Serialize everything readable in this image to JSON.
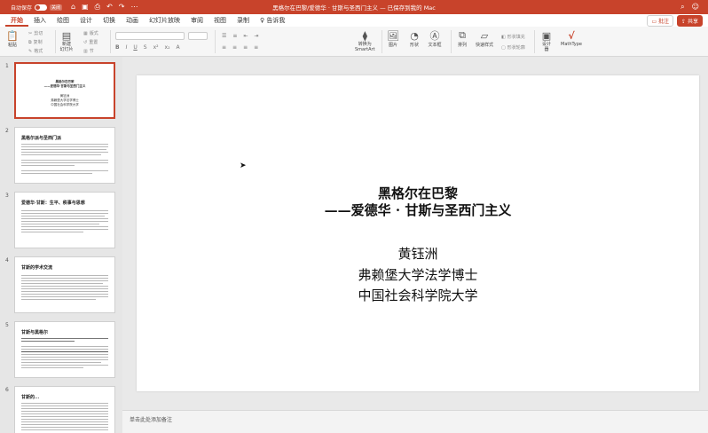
{
  "titlebar": {
    "autosave_label": "自动保存",
    "toggle_label": "关闭",
    "doc_title": "黑格尔在巴黎/爱德华 · 甘斯与圣西门主义 — 已保存到我的 Mac",
    "accent_color": "#c8432b"
  },
  "tabs": [
    "开始",
    "插入",
    "绘图",
    "设计",
    "切换",
    "动画",
    "幻灯片放映",
    "审阅",
    "视图",
    "录制",
    "告诉我"
  ],
  "tab_right": {
    "comments": "批注",
    "share": "共享"
  },
  "ribbon": {
    "paste": "粘贴",
    "cut": "剪切",
    "copy": "复制",
    "format": "格式",
    "new_slide": "新建\n幻灯片",
    "layout": "版式",
    "reset": "重置",
    "section": "节",
    "convert_smartart": "转换为\nSmartArt",
    "picture": "图片",
    "shape": "形状",
    "textbox": "文本框",
    "arrange": "排列",
    "quick_styles": "快速样式",
    "shape_fill": "形状填充",
    "shape_outline": "形状轮廓",
    "designer": "设计\n器",
    "mathtype": "MathType"
  },
  "thumbnails": [
    {
      "num": "1",
      "lines": [
        "黑格尔在巴黎",
        "——爱德华·甘斯与圣西门主义",
        "黄钰洲",
        "弗赖堡大学法学博士",
        "中国社会科学院大学"
      ]
    },
    {
      "num": "2",
      "title": "黑格尔派与圣西门派"
    },
    {
      "num": "3",
      "title": "爱德华·甘斯：生平、秩事与思想"
    },
    {
      "num": "4",
      "title": "甘斯的学术交流"
    },
    {
      "num": "5",
      "title": "甘斯与黑格尔"
    },
    {
      "num": "6",
      "title": "甘斯的..."
    }
  ],
  "slide": {
    "title_line1": "黑格尔在巴黎",
    "title_line2": "——爱德华 · 甘斯与圣西门主义",
    "author": "黄钰洲",
    "affiliation1": "弗赖堡大学法学博士",
    "affiliation2": "中国社会科学院大学"
  },
  "notes_placeholder": "单击此处添加备注"
}
